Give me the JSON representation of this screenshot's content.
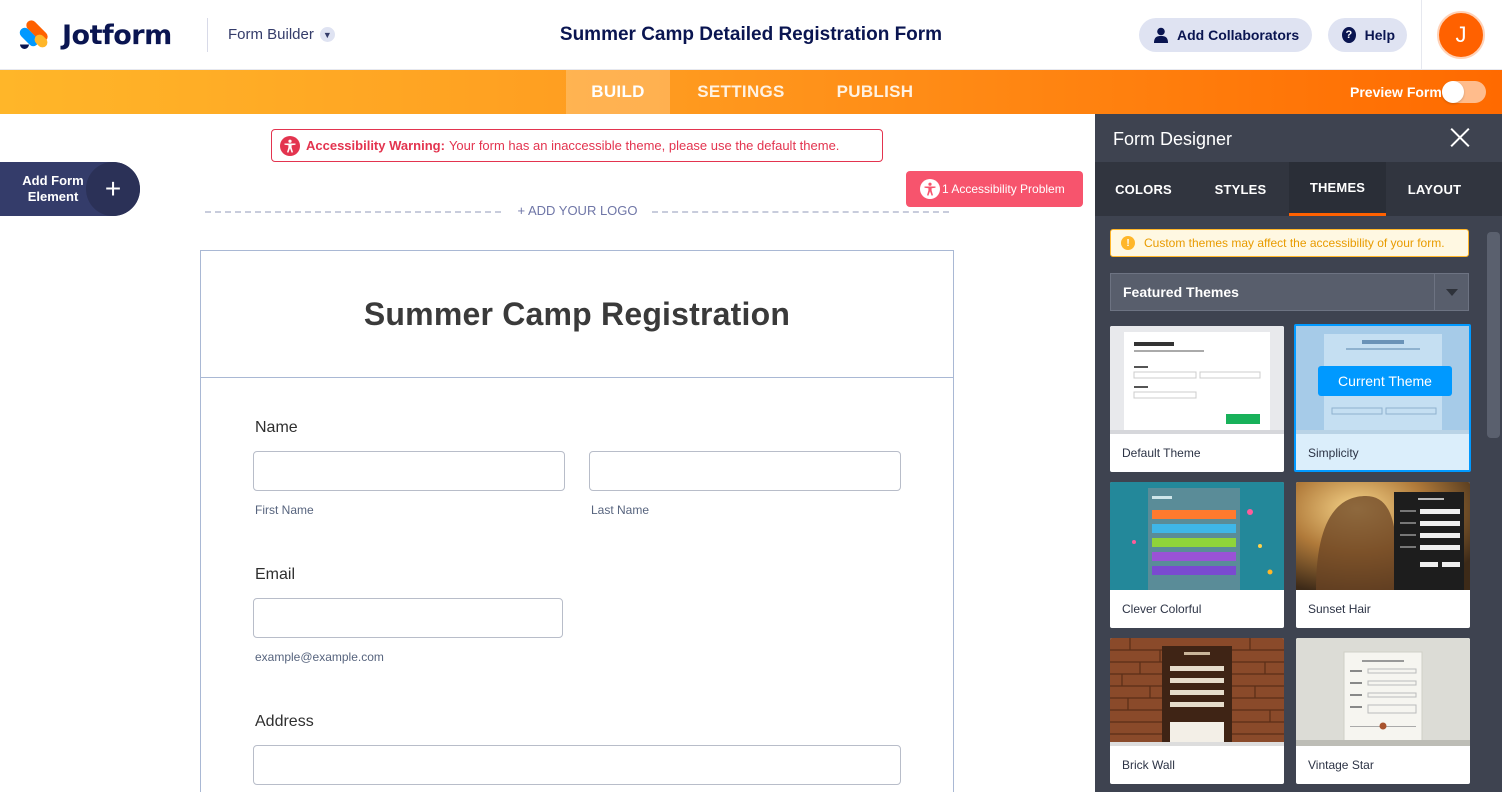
{
  "header": {
    "brand": "Jotform",
    "builder_menu": "Form Builder",
    "form_title": "Summer Camp Detailed Registration Form",
    "add_collaborators": "Add Collaborators",
    "help": "Help",
    "avatar_initial": "J"
  },
  "nav": {
    "tabs": [
      {
        "label": "BUILD",
        "active": true
      },
      {
        "label": "SETTINGS",
        "active": false
      },
      {
        "label": "PUBLISH",
        "active": false
      }
    ],
    "preview_label": "Preview Form",
    "preview_on": false
  },
  "canvas": {
    "warning_title": "Accessibility Warning:",
    "warning_text": "Your form has an inaccessible theme, please use the default theme.",
    "add_element_label": "Add Form Element",
    "accessibility_problem": "1 Accessibility Problem",
    "add_logo": "+ ADD YOUR LOGO"
  },
  "form": {
    "heading": "Summer Camp Registration",
    "fields": {
      "name_label": "Name",
      "first_name_sublabel": "First Name",
      "last_name_sublabel": "Last Name",
      "email_label": "Email",
      "email_sublabel": "example@example.com",
      "address_label": "Address"
    }
  },
  "designer": {
    "title": "Form Designer",
    "tabs": [
      {
        "label": "COLORS",
        "active": false
      },
      {
        "label": "STYLES",
        "active": false
      },
      {
        "label": "THEMES",
        "active": true
      },
      {
        "label": "LAYOUT",
        "active": false
      }
    ],
    "notice": "Custom themes may affect the accessibility of your form.",
    "theme_category": "Featured Themes",
    "current_theme_badge": "Current Theme",
    "themes": [
      {
        "name": "Default Theme",
        "selected": false
      },
      {
        "name": "Simplicity",
        "selected": true
      },
      {
        "name": "Clever Colorful",
        "selected": false
      },
      {
        "name": "Sunset Hair",
        "selected": false
      },
      {
        "name": "Brick Wall",
        "selected": false
      },
      {
        "name": "Vintage Star",
        "selected": false
      }
    ]
  },
  "colors": {
    "brand_orange": "#ff6100",
    "navy": "#0a1551",
    "warning_red": "#e3344f",
    "selected_blue": "#0099ff"
  }
}
